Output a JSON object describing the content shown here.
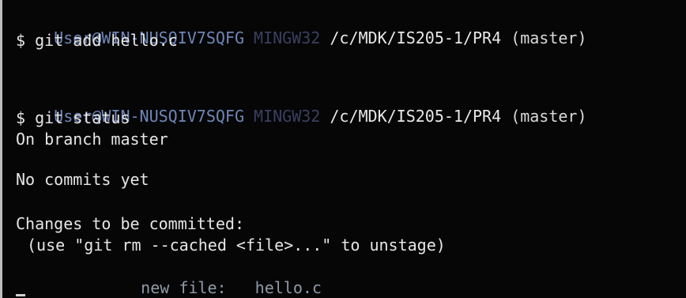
{
  "terminal": {
    "prompt": {
      "user_host": "User@WIN-NUSQIV7SQFG",
      "system": "MINGW32",
      "path": "/c/MDK/IS205-1/PR4",
      "branch": "(master)"
    },
    "command_1": "$ git add hello.c",
    "command_2": "$ git status",
    "output": {
      "branch_line": "On branch master",
      "commits_line": "No commits yet",
      "changes_header": "Changes to be committed:",
      "hint": "(use \"git rm --cached <file>...\" to unstage)",
      "staged_label": "new file:",
      "staged_file": "hello.c"
    },
    "colors": {
      "background": "#060606",
      "user": "#6f86b8",
      "host": "#3b3f61",
      "text": "#e6e6e6",
      "staged": "#8f9aa8"
    }
  }
}
